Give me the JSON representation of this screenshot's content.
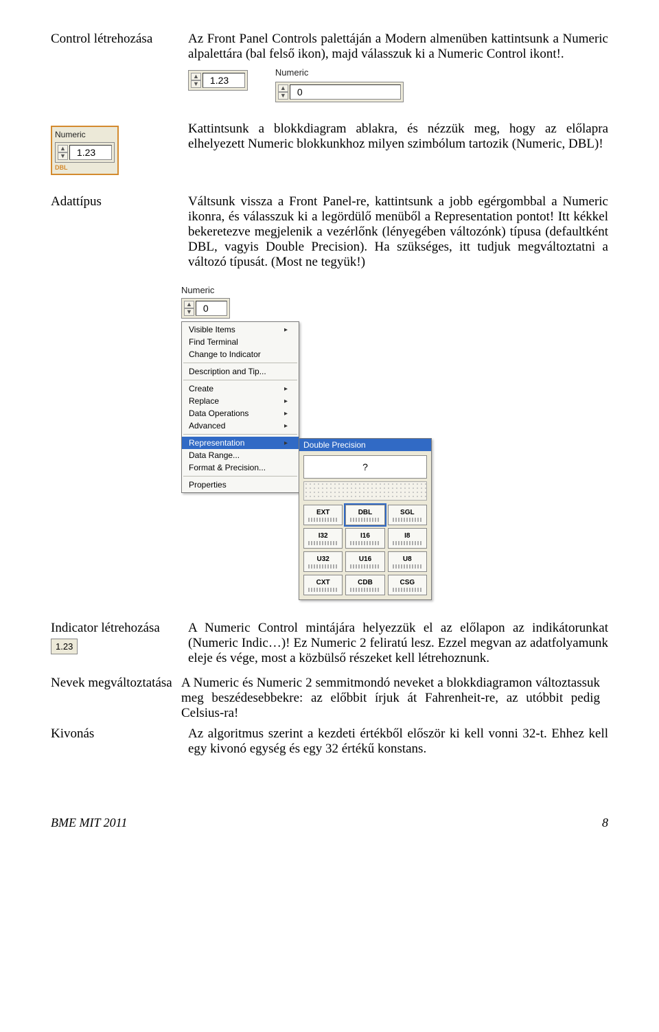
{
  "heading1": "Control létrehozása",
  "para1": "Az Front Panel Controls palettáján a Modern almenüben kattintsunk a Numeric alpalettára (bal felső ikon), majd válasszuk ki a Numeric Control ikont!.",
  "inline1_value": "1.23",
  "inline2_caption": "Numeric",
  "inline2_value": "0",
  "palette_caption": "Numeric",
  "palette_value": "1.23",
  "palette_dbl": "DBL",
  "para2": "Kattintsunk a blokkdiagram ablakra, és nézzük meg, hogy az előlapra elhelyezett Numeric blokkunkhoz milyen szimbólum tartozik (Numeric, DBL)!",
  "heading2": "Adattípus",
  "para3": "Váltsunk vissza a Front Panel-re, kattintsunk a jobb egérgombbal a Numeric ikonra, és válasszuk ki a legördülő menüből a Representation pontot! Itt kékkel bekeretezve megjelenik a vezérlőnk (lényegében változónk) típusa (defaultként DBL, vagyis Double Precision). Ha szükséges, itt tudjuk megváltoztatni a változó típusát. (Most ne tegyük!)",
  "ctx_header_caption": "Numeric",
  "ctx_header_value": "0",
  "menu": {
    "items": [
      "Visible Items",
      "Find Terminal",
      "Change to Indicator",
      "Description and Tip...",
      "Create",
      "Replace",
      "Data Operations",
      "Advanced",
      "Representation",
      "Data Range...",
      "Format & Precision...",
      "Properties"
    ]
  },
  "submenu_title": "Double Precision",
  "types": [
    "EXT",
    "DBL",
    "SGL",
    "I32",
    "I16",
    "I8",
    "U32",
    "U16",
    "U8",
    "CXT",
    "CDB",
    "CSG"
  ],
  "heading3": "Indicator létrehozása",
  "indicator_icon_value": "1.23",
  "para4": "A Numeric Control mintájára helyezzük el az előlapon az indikátorunkat (Numeric Indic…)! Ez Numeric 2 feliratú lesz. Ezzel megvan az adatfolyamunk eleje és vége, most a közbülső részeket kell létrehoznunk.",
  "heading4_full": "Nevek megváltoztatása",
  "para5": "A Numeric és Numeric 2 semmitmondó neveket a blokkdiagramon változtassuk meg beszédesebbekre: az előbbit írjuk át Fahrenheit-re, az utóbbit pedig Celsius-ra!",
  "heading5": "Kivonás",
  "para6": "Az algoritmus szerint a kezdeti értékből először ki kell vonni 32-t. Ehhez kell egy kivonó egység és egy 32 értékű konstans.",
  "footer_left": "BME MIT 2011",
  "footer_right": "8"
}
